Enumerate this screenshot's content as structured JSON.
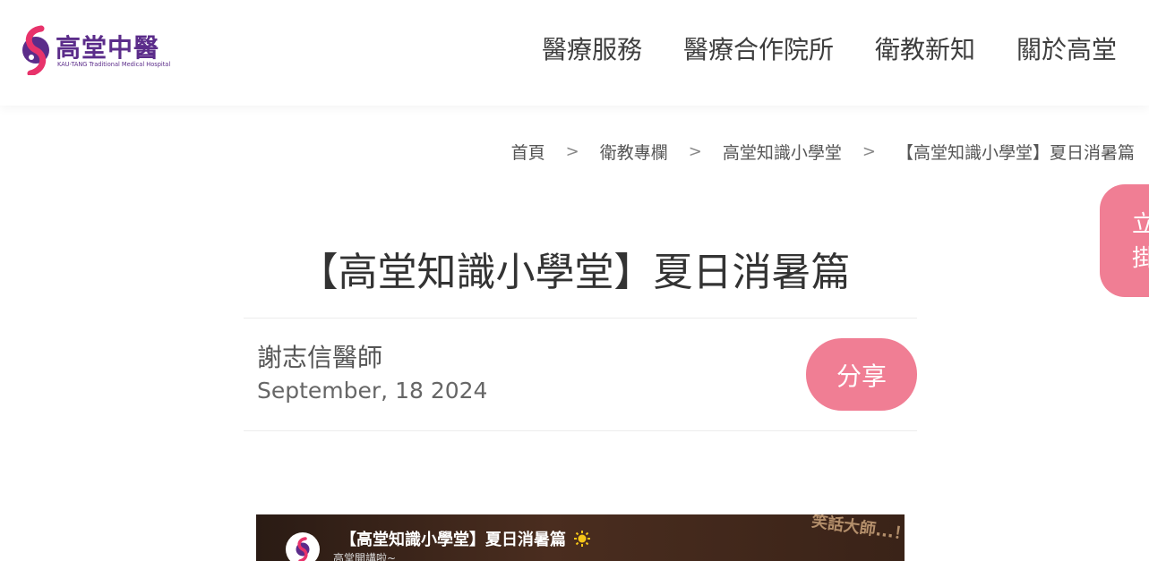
{
  "brand": {
    "name_cn": "高堂中醫",
    "name_en": "KAU-TANG Traditional Medical Hospital",
    "color": "#5b2c8a",
    "accent": "#e8336b",
    "logo_icon": "tai-chi-s-logo"
  },
  "nav": {
    "items": [
      "醫療服務",
      "醫療合作院所",
      "衛教新知",
      "關於高堂"
    ]
  },
  "breadcrumb": {
    "items": [
      "首頁",
      "衛教專欄",
      "高堂知識小學堂",
      "【高堂知識小學堂】夏日消暑篇"
    ],
    "separator": ">"
  },
  "side_tab": {
    "label": "立掛"
  },
  "article": {
    "title": "【高堂知識小學堂】夏日消暑篇",
    "author": "謝志信醫師",
    "date": "September, 18 2024",
    "share_label": "分享"
  },
  "video": {
    "title": "【高堂知識小學堂】夏日消暑篇",
    "subtitle": "高堂開講啦~",
    "overlay_text": "笑話大師...！？",
    "badge_icon": "sun-icon"
  },
  "colors": {
    "pink": "#f07e94",
    "text": "#444444"
  }
}
